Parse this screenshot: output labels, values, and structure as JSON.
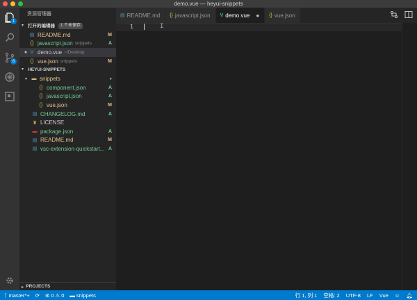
{
  "window": {
    "title": "demo.vue — heyui-snippets",
    "traffic_lights": [
      "#fe5f57",
      "#febc2e",
      "#28c840"
    ]
  },
  "colors": {
    "modified": "#e2c08d",
    "added": "#73c991",
    "accent": "#007acc",
    "json_icon": "#cbcb41",
    "vue_icon": "#41b883",
    "md_icon": "#519aba",
    "folder": "#dcb67a"
  },
  "activity_bar": {
    "explorer_badge": "1",
    "scm_badge": "6"
  },
  "sidebar": {
    "title": "资源管理器",
    "open_editors": {
      "header": "打开的编辑器",
      "unsaved_pill": "1 个未保存",
      "items": [
        {
          "name": "README.md",
          "icon": "markdown-icon",
          "sub": "",
          "status": "M"
        },
        {
          "name": "javascript.json",
          "icon": "json-icon",
          "sub": "snippets",
          "status": "A"
        },
        {
          "name": "demo.vue",
          "icon": "vue-icon",
          "sub": "~/Desktop",
          "status": ""
        },
        {
          "name": "vue.json",
          "icon": "json-icon",
          "sub": "snippets",
          "status": "M"
        }
      ]
    },
    "workspace": {
      "header": "HEYUI-SNIPPETS",
      "folder": "snippets",
      "folder_items": [
        {
          "name": "component.json",
          "icon": "json-icon",
          "status": "A"
        },
        {
          "name": "javascript.json",
          "icon": "json-icon",
          "status": "A"
        },
        {
          "name": "vue.json",
          "icon": "json-icon",
          "status": "M"
        }
      ],
      "root_items": [
        {
          "name": "CHANGELOG.md",
          "icon": "markdown-icon",
          "status": "A"
        },
        {
          "name": "LICENSE",
          "icon": "license-icon",
          "status": ""
        },
        {
          "name": "package.json",
          "icon": "npm-icon",
          "status": "A"
        },
        {
          "name": "README.md",
          "icon": "markdown-icon",
          "status": "M"
        },
        {
          "name": "vsc-extension-quickstart...",
          "icon": "markdown-icon",
          "status": "A"
        }
      ]
    },
    "projects": "PROJECTS"
  },
  "tabs": [
    {
      "label": "README.md",
      "icon": "markdown-icon",
      "active": false
    },
    {
      "label": "javascript.json",
      "icon": "json-icon",
      "active": false
    },
    {
      "label": "demo.vue",
      "icon": "vue-icon",
      "active": true
    },
    {
      "label": "vue.json",
      "icon": "json-icon",
      "active": false
    }
  ],
  "editor": {
    "line_number": "1"
  },
  "statusbar": {
    "branch": "master*+",
    "errors": "0",
    "warnings": "0",
    "folder": "snippets",
    "position": "行 1, 列 1",
    "indent": "空格: 2",
    "encoding": "UTF-8",
    "eol": "LF",
    "language": "Vue"
  }
}
